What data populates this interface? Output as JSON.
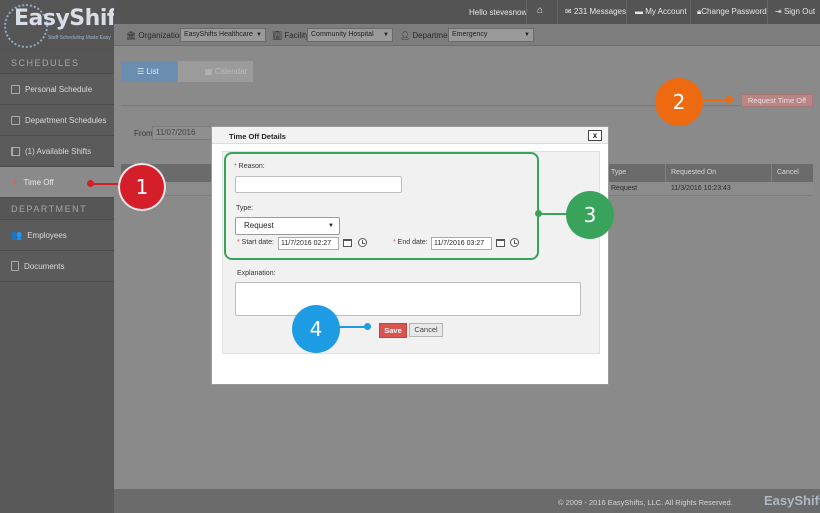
{
  "brand": {
    "name": "EasyShifts",
    "tagline": "Staff Scheduling Made Easy"
  },
  "sidebar": {
    "sections": [
      {
        "title": "SCHEDULES",
        "items": [
          {
            "label": "Personal Schedule",
            "icon": "calendar-icon"
          },
          {
            "label": "Department Schedules",
            "icon": "calendar-icon"
          },
          {
            "label": "(1) Available Shifts",
            "icon": "flag-icon"
          },
          {
            "label": "Time Off",
            "icon": "plane-icon",
            "active": true
          }
        ]
      },
      {
        "title": "DEPARTMENT",
        "items": [
          {
            "label": "Employees",
            "icon": "users-icon"
          },
          {
            "label": "Documents",
            "icon": "document-icon"
          }
        ]
      }
    ]
  },
  "topbar": {
    "greeting": "Hello stevesnow",
    "messages": "231 Messages",
    "account": "My Account",
    "password": "Change Password",
    "signout": "Sign Out"
  },
  "filters": {
    "organization_label": "Organization:",
    "organization_value": "EasyShifts Healthcare",
    "facility_label": "Facility:",
    "facility_value": "Community Hospital",
    "department_label": "Department:",
    "department_value": "Emergency"
  },
  "main": {
    "tabs": {
      "list": "List",
      "calendar": "Calendar"
    },
    "request_button": "Request Time Off",
    "from_label": "From:",
    "from_value": "11/07/2016",
    "grid": {
      "columns": [
        "Type",
        "Requested On",
        "Cancel"
      ],
      "rows": [
        {
          "type": "Request",
          "requested_on": "11/3/2016 10:23:43",
          "cancel": ""
        }
      ]
    }
  },
  "modal": {
    "title": "Time Off Details",
    "close": "x",
    "reason_label": "Reason:",
    "reason_value": "",
    "type_label": "Type:",
    "type_value": "Request",
    "start_label": "Start date:",
    "start_value": "11/7/2016 02:27",
    "end_label": "End date:",
    "end_value": "11/7/2016 03:27",
    "explanation_label": "Explanation:",
    "explanation_value": "",
    "save": "Save",
    "cancel": "Cancel"
  },
  "callouts": [
    "1",
    "2",
    "3",
    "4"
  ],
  "footer": {
    "copyright": "© 2009 - 2016 EasyShifts, LLC. All Rights Reserved.",
    "logo": "EasyShifts"
  },
  "colors": {
    "save": "#d9534f",
    "callout1": "#d41f2a",
    "callout2": "#ee6a10",
    "callout3": "#3aa35b",
    "callout4": "#1d9be3",
    "tab_active": "#6a8db0"
  }
}
